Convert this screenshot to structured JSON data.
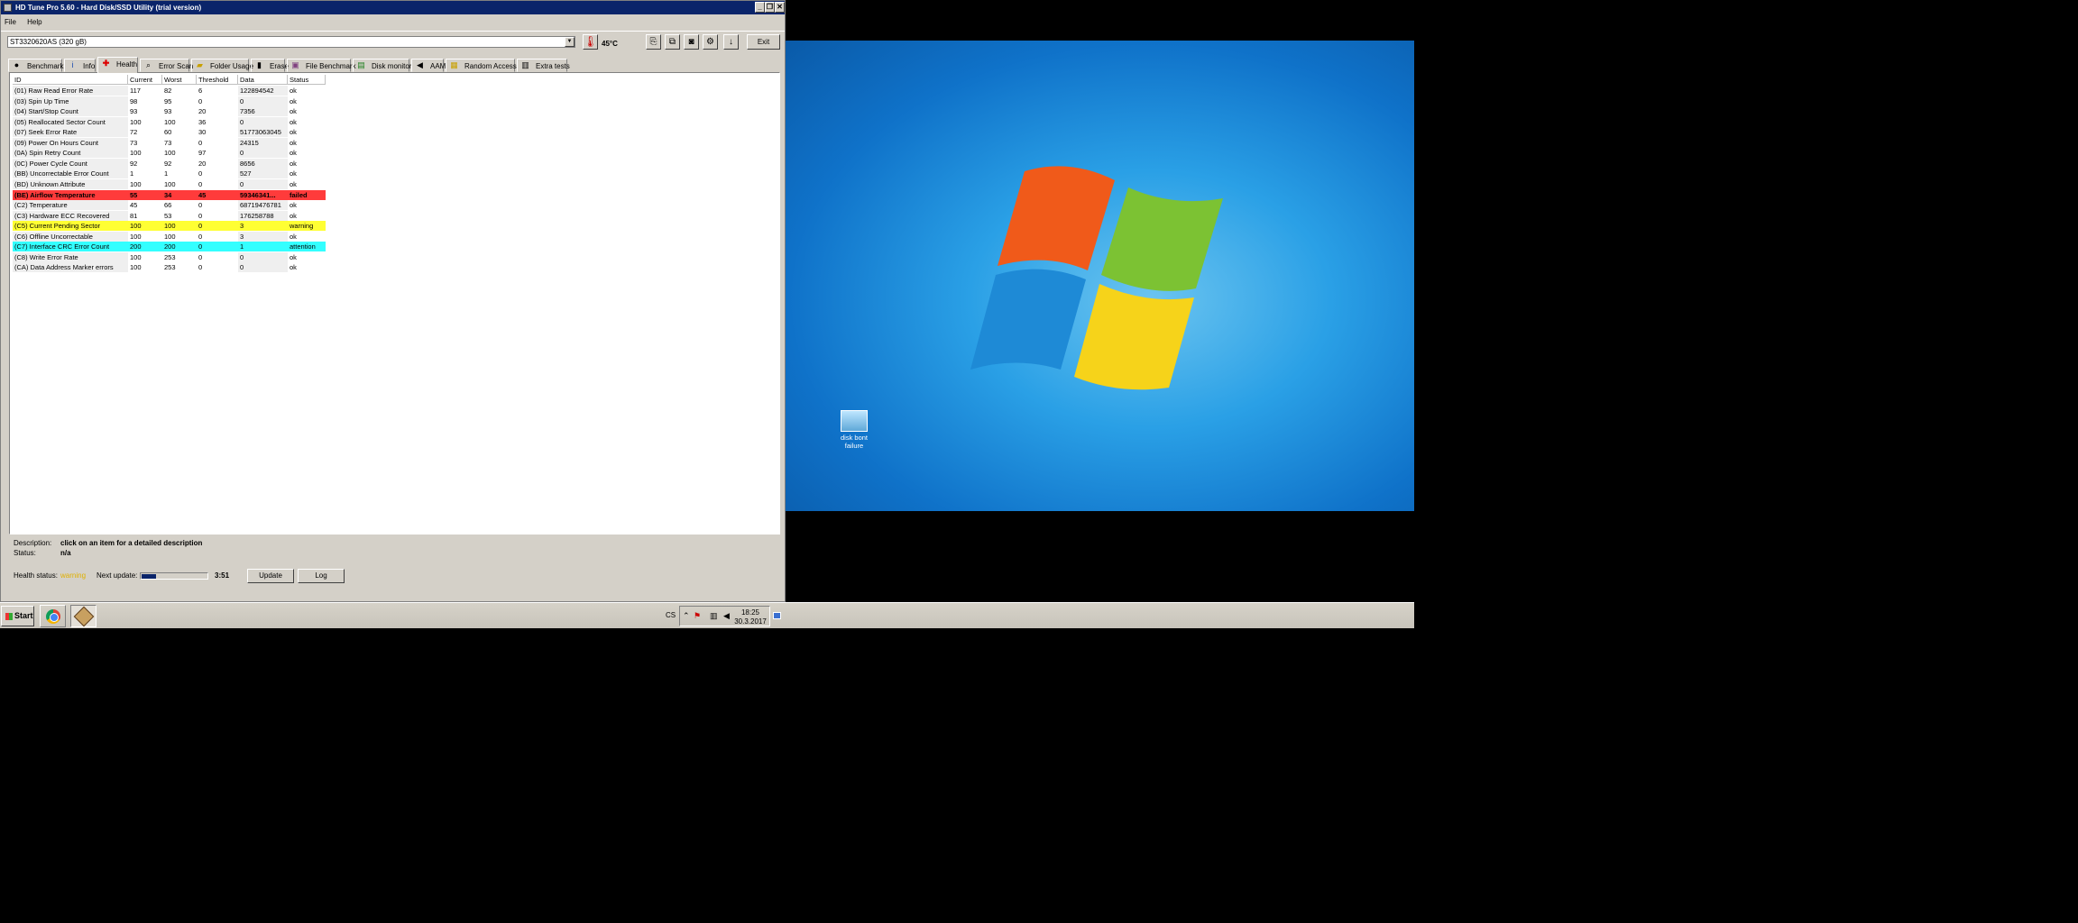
{
  "window": {
    "title": "HD Tune Pro 5.60 - Hard Disk/SSD Utility (trial version)",
    "controls": [
      "_",
      "❐",
      "✕"
    ]
  },
  "menu": [
    "File",
    "Help"
  ],
  "drive": {
    "selected": "ST3320620AS (320 gB)",
    "temperature": "45°C",
    "exit_label": "Exit"
  },
  "toolbar_icons": [
    "copy-text-icon",
    "copy-screenshot-icon",
    "camera-icon",
    "options-icon",
    "save-icon"
  ],
  "tabs": [
    {
      "label": "Benchmark",
      "icon": "benchmark-icon",
      "active": false
    },
    {
      "label": "Info",
      "icon": "info-icon",
      "active": false
    },
    {
      "label": "Health",
      "icon": "health-icon",
      "active": true
    },
    {
      "label": "Error Scan",
      "icon": "error-scan-icon",
      "active": false
    },
    {
      "label": "Folder Usage",
      "icon": "folder-icon",
      "active": false
    },
    {
      "label": "Erase",
      "icon": "erase-icon",
      "active": false
    },
    {
      "label": "File Benchmark",
      "icon": "file-benchmark-icon",
      "active": false
    },
    {
      "label": "Disk monitor",
      "icon": "disk-monitor-icon",
      "active": false
    },
    {
      "label": "AAM",
      "icon": "speaker-icon",
      "active": false
    },
    {
      "label": "Random Access",
      "icon": "random-access-icon",
      "active": false
    },
    {
      "label": "Extra tests",
      "icon": "extra-tests-icon",
      "active": false
    }
  ],
  "health_table": {
    "columns": [
      "ID",
      "Current",
      "Worst",
      "Threshold",
      "Data",
      "Status"
    ],
    "rows": [
      {
        "id": "(01) Raw Read Error Rate",
        "current": "117",
        "worst": "82",
        "threshold": "6",
        "data": "122894542",
        "status": "ok"
      },
      {
        "id": "(03) Spin Up Time",
        "current": "98",
        "worst": "95",
        "threshold": "0",
        "data": "0",
        "status": "ok"
      },
      {
        "id": "(04) Start/Stop Count",
        "current": "93",
        "worst": "93",
        "threshold": "20",
        "data": "7356",
        "status": "ok"
      },
      {
        "id": "(05) Reallocated Sector Count",
        "current": "100",
        "worst": "100",
        "threshold": "36",
        "data": "0",
        "status": "ok"
      },
      {
        "id": "(07) Seek Error Rate",
        "current": "72",
        "worst": "60",
        "threshold": "30",
        "data": "51773063045",
        "status": "ok"
      },
      {
        "id": "(09) Power On Hours Count",
        "current": "73",
        "worst": "73",
        "threshold": "0",
        "data": "24315",
        "status": "ok"
      },
      {
        "id": "(0A) Spin Retry Count",
        "current": "100",
        "worst": "100",
        "threshold": "97",
        "data": "0",
        "status": "ok"
      },
      {
        "id": "(0C) Power Cycle Count",
        "current": "92",
        "worst": "92",
        "threshold": "20",
        "data": "8656",
        "status": "ok"
      },
      {
        "id": "(BB) Uncorrectable Error Count",
        "current": "1",
        "worst": "1",
        "threshold": "0",
        "data": "527",
        "status": "ok"
      },
      {
        "id": "(BD) Unknown Attribute",
        "current": "100",
        "worst": "100",
        "threshold": "0",
        "data": "0",
        "status": "ok"
      },
      {
        "id": "(BE) Airflow Temperature",
        "current": "55",
        "worst": "34",
        "threshold": "45",
        "data": "59346341...",
        "status": "failed"
      },
      {
        "id": "(C2) Temperature",
        "current": "45",
        "worst": "66",
        "threshold": "0",
        "data": "68719476781",
        "status": "ok"
      },
      {
        "id": "(C3) Hardware ECC Recovered",
        "current": "81",
        "worst": "53",
        "threshold": "0",
        "data": "176258788",
        "status": "ok"
      },
      {
        "id": "(C5) Current Pending Sector",
        "current": "100",
        "worst": "100",
        "threshold": "0",
        "data": "3",
        "status": "warning"
      },
      {
        "id": "(C6) Offline Uncorrectable",
        "current": "100",
        "worst": "100",
        "threshold": "0",
        "data": "3",
        "status": "ok"
      },
      {
        "id": "(C7) Interface CRC Error Count",
        "current": "200",
        "worst": "200",
        "threshold": "0",
        "data": "1",
        "status": "attention"
      },
      {
        "id": "(C8) Write Error Rate",
        "current": "100",
        "worst": "253",
        "threshold": "0",
        "data": "0",
        "status": "ok"
      },
      {
        "id": "(CA) Data Address Marker errors",
        "current": "100",
        "worst": "253",
        "threshold": "0",
        "data": "0",
        "status": "ok"
      }
    ]
  },
  "description": {
    "label": "Description:",
    "value": "click on an item for a detailed description",
    "status_label": "Status:",
    "status_value": "n/a"
  },
  "footer": {
    "health_label": "Health status:",
    "health_value": "warning",
    "next_update_label": "Next update:",
    "progress": 0.22,
    "countdown": "3:51",
    "update_label": "Update",
    "log_label": "Log"
  },
  "desktop": {
    "icon_label": "disk bont failure"
  },
  "taskbar": {
    "start_label": "Start",
    "apps": [
      "chrome",
      "hd-tune"
    ],
    "language": "CS",
    "time": "18:25",
    "date": "30.3.2017"
  },
  "colors": {
    "titlebar": "#0a246a",
    "failed": "#ff3b3b",
    "warning": "#ffff33",
    "attention": "#33ffff",
    "health_warning_text": "#e0b000"
  }
}
